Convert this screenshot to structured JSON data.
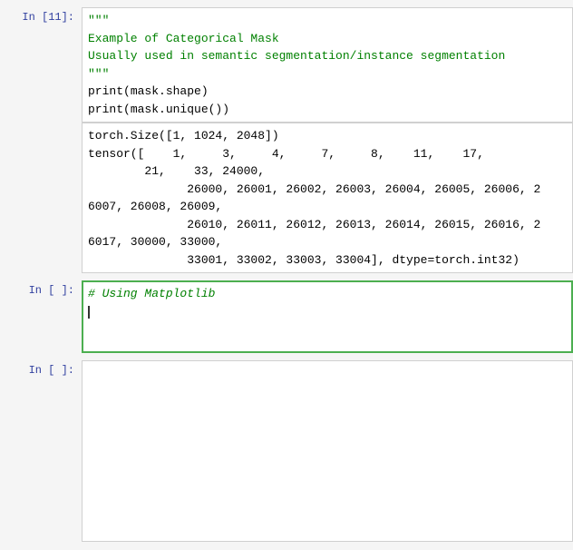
{
  "cells": [
    {
      "label": "In [11]:",
      "type": "code",
      "active": false,
      "lines": [
        {
          "type": "string",
          "text": "\"\"\""
        },
        {
          "type": "string",
          "text": "Example of Categorical Mask"
        },
        {
          "type": "string",
          "text": "Usually used in semantic segmentation/instance segmentation"
        },
        {
          "type": "string",
          "text": "\"\"\""
        },
        {
          "type": "mixed",
          "parts": [
            {
              "style": "func",
              "text": "print"
            },
            {
              "style": "normal",
              "text": "(mask.shape)"
            }
          ]
        },
        {
          "type": "mixed",
          "parts": [
            {
              "style": "func",
              "text": "print"
            },
            {
              "style": "normal",
              "text": "(mask.unique())"
            }
          ]
        }
      ],
      "output": {
        "lines": [
          "torch.Size([1, 1024, 2048])",
          "tensor([    1,     3,     4,     7,     8,    11,    17,",
          "        21,    33, 24000,",
          "              26000, 26001, 26002, 26003, 26004, 26005, 26006, 2",
          "6007, 26008, 26009,",
          "              26010, 26011, 26012, 26013, 26014, 26015, 26016, 2",
          "6017, 30000, 33000,",
          "              33001, 33002, 33003, 33004], dtype=torch.int32)"
        ]
      }
    },
    {
      "label": "In [ ]:",
      "type": "code",
      "active": true,
      "lines": [
        {
          "type": "comment",
          "text": "# Using Matplotlib"
        }
      ],
      "hasCursor": true
    },
    {
      "label": "In [ ]:",
      "type": "code",
      "active": false,
      "empty": true,
      "lines": []
    }
  ],
  "colors": {
    "string": "#008000",
    "comment": "#008000",
    "active_border": "#4caf50",
    "label": "#303f9f"
  }
}
